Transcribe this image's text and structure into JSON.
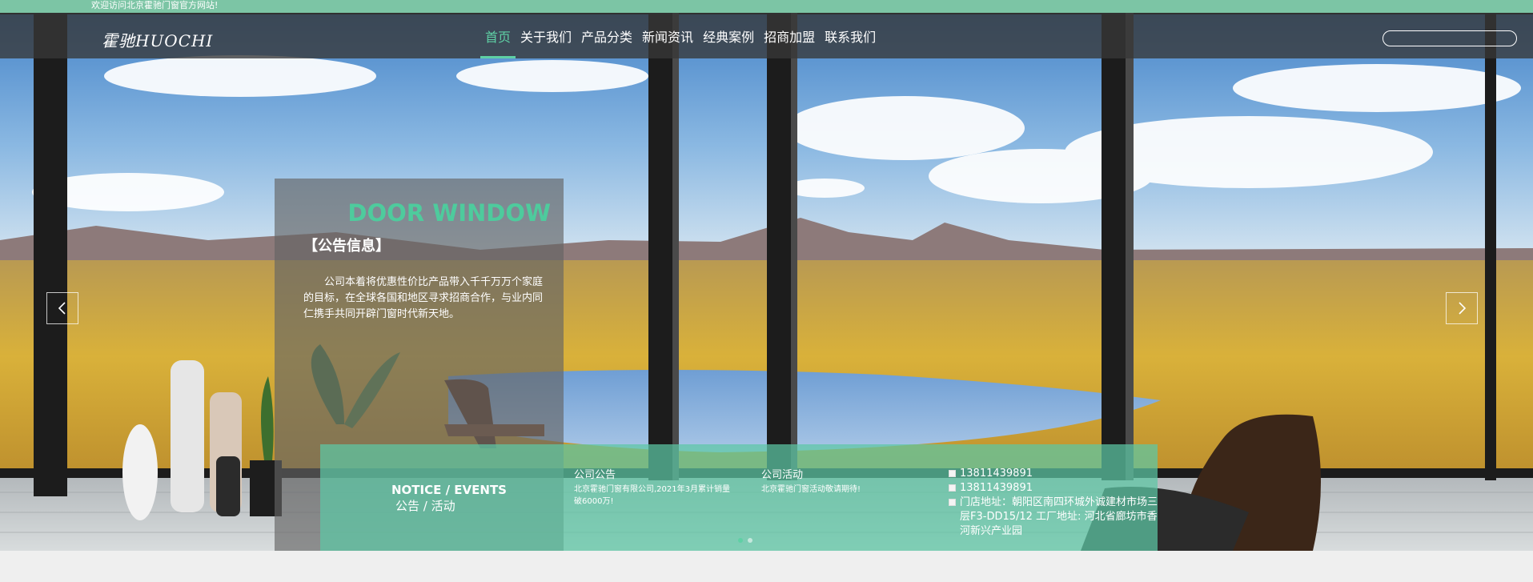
{
  "topbar": {
    "welcome": "欢迎访问北京霍驰门窗官方网站!"
  },
  "header": {
    "logo": "霍驰HUOCHI",
    "nav": [
      {
        "label": "首页",
        "active": true
      },
      {
        "label": "关于我们"
      },
      {
        "label": "产品分类"
      },
      {
        "label": "新闻资讯"
      },
      {
        "label": "经典案例"
      },
      {
        "label": "招商加盟"
      },
      {
        "label": "联系我们"
      }
    ],
    "search": {
      "value": "",
      "placeholder": ""
    }
  },
  "panel": {
    "title": "DOOR WINDOW",
    "heading": "【公告信息】",
    "text": "公司本着将优惠性价比产品带入千千万万个家庭的目标，在全球各国和地区寻求招商合作，与业内同仁携手共同开辟门窗时代新天地。"
  },
  "band": {
    "section_title": "NOTICE / EVENTS",
    "section_subtitle": "公告 / 活动",
    "notice_heading": "公司公告",
    "notice_text": "北京霍驰门窗有限公司,2021年3月累计销量破6000万!",
    "event_heading": "公司活动",
    "event_text": "北京霍驰门窗活动敬请期待!",
    "phone1": "13811439891",
    "phone2": "13811439891",
    "address": "门店地址：朝阳区南四环城外诚建材市场三层F3-DD15/12 工厂地址: 河北省廊坊市香河新兴产业园"
  },
  "carousel": {
    "slides": 2,
    "active": 1
  },
  "colors": {
    "accent": "#5fd0a5",
    "topbar": "#7cc5a5",
    "navbar": "#373737"
  },
  "icons": {
    "prev": "chevron-left-icon",
    "next": "chevron-right-icon",
    "phone": "broken-image-icon"
  }
}
